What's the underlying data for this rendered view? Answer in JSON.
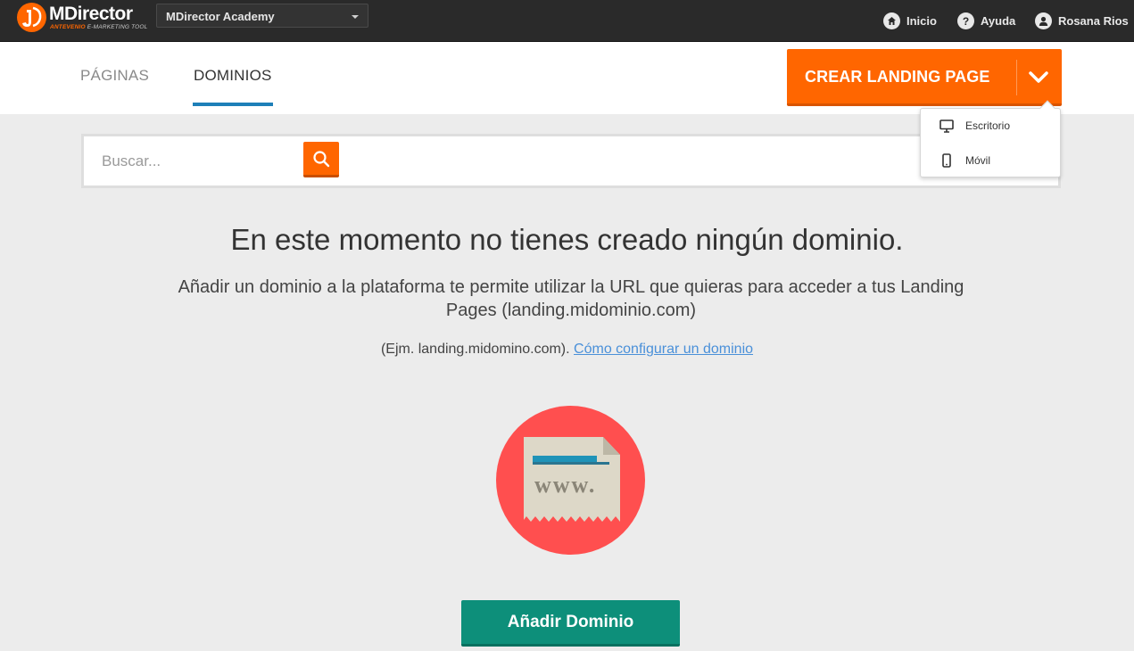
{
  "app": {
    "logo_title": "MDirector",
    "logo_brand": "ANTEVENIO",
    "logo_tagline": "E-MARKETING TOOL",
    "account_selector": "MDirector Academy"
  },
  "topnav": {
    "home": "Inicio",
    "help": "Ayuda",
    "user": "Rosana Rios"
  },
  "tabs": {
    "paginas": "PÁGINAS",
    "dominios": "DOMINIOS",
    "active": "DOMINIOS"
  },
  "create_button": {
    "label": "CREAR LANDING PAGE"
  },
  "create_menu": {
    "items": [
      {
        "label": "Escritorio",
        "icon": "desktop-icon"
      },
      {
        "label": "Móvil",
        "icon": "mobile-icon"
      }
    ]
  },
  "search": {
    "placeholder": "Buscar..."
  },
  "empty_state": {
    "title": "En este momento no tienes creado ningún dominio.",
    "description": "Añadir un dominio a la plataforma te permite utilizar la URL que quieras para acceder a tus Landing Pages (landing.midominio.com)",
    "example_text": "(Ejm. landing.midomino.com).",
    "help_link": "Cómo configurar un dominio",
    "illustration_text": "www.",
    "add_button": "Añadir Dominio"
  },
  "colors": {
    "primary_orange": "#ff6600",
    "tab_underline": "#1e7fb8",
    "add_button_green": "#0d8f7a",
    "illustration_red": "#ff4f4f",
    "link_blue": "#4a90d9"
  }
}
